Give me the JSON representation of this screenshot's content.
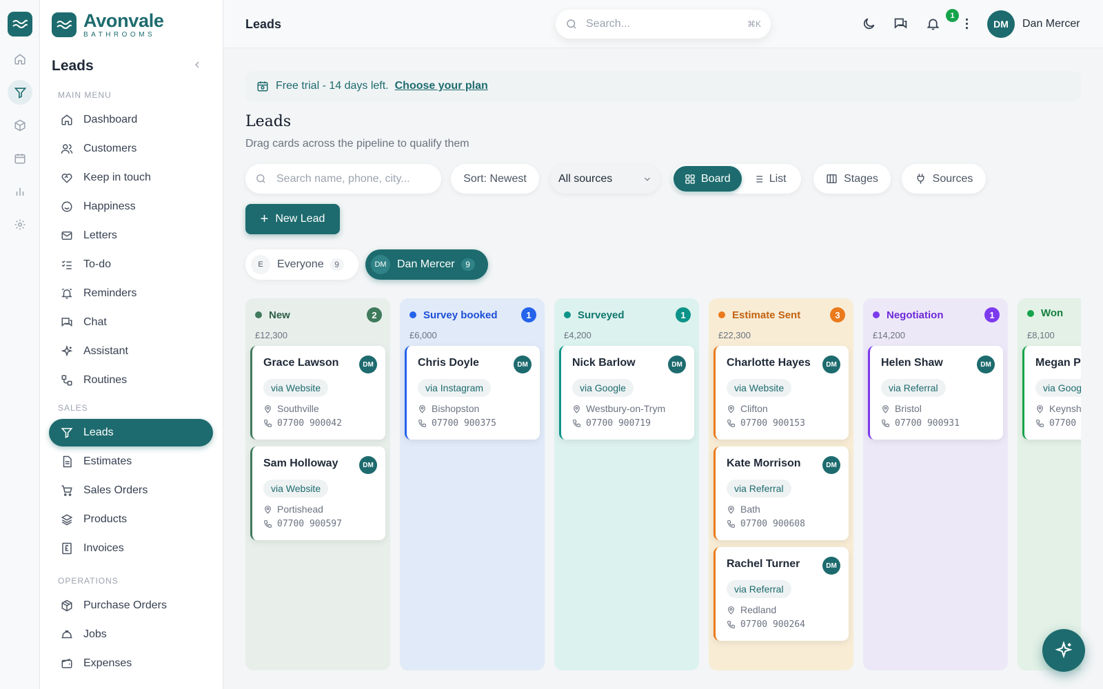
{
  "app": {
    "name": "Avonvale",
    "tagline": "BATHROOMS"
  },
  "sidebar": {
    "title": "Leads",
    "sections": {
      "main": "MAIN MENU",
      "sales": "SALES",
      "operations": "OPERATIONS"
    },
    "main_items": [
      "Dashboard",
      "Customers",
      "Keep in touch",
      "Happiness",
      "Letters",
      "To-do",
      "Reminders",
      "Chat",
      "Assistant",
      "Routines"
    ],
    "sales_items": [
      "Leads",
      "Estimates",
      "Sales Orders",
      "Products",
      "Invoices"
    ],
    "operations_items": [
      "Purchase Orders",
      "Jobs",
      "Expenses"
    ],
    "active": "Leads"
  },
  "topbar": {
    "page_title": "Leads",
    "search_placeholder": "Search...",
    "search_shortcut": "⌘K",
    "notification_count": "1",
    "user_initials": "DM",
    "user_name": "Dan Mercer"
  },
  "trial": {
    "text": "Free trial - 14 days left.",
    "link": "Choose your plan"
  },
  "page": {
    "heading": "Leads",
    "subtitle": "Drag cards across the pipeline to qualify them"
  },
  "toolbar": {
    "search_placeholder": "Search name, phone, city...",
    "sort": "Sort: Newest",
    "source_filter": "All sources",
    "view_board": "Board",
    "view_list": "List",
    "active_view": "Board",
    "stages": "Stages",
    "sources": "Sources",
    "new_lead": "New Lead"
  },
  "owners": [
    {
      "initial": "E",
      "label": "Everyone",
      "count": "9",
      "active": false
    },
    {
      "initial": "DM",
      "label": "Dan Mercer",
      "count": "9",
      "active": true
    }
  ],
  "colors": {
    "accent": "#1d6b6e"
  },
  "columns": [
    {
      "name": "New",
      "count": "2",
      "total": "£12,300",
      "color": "#3f7a5c",
      "text": "#2f5e46",
      "bg": "#e8efeb",
      "cards": [
        {
          "name": "Grace Lawson",
          "initials": "DM",
          "source": "via Website",
          "location": "Southville",
          "phone": "07700 900042"
        },
        {
          "name": "Sam Holloway",
          "initials": "DM",
          "source": "via Website",
          "location": "Portishead",
          "phone": "07700 900597"
        }
      ]
    },
    {
      "name": "Survey booked",
      "count": "1",
      "total": "£6,000",
      "color": "#2563eb",
      "text": "#1d4ed8",
      "bg": "#e0eaf8",
      "cards": [
        {
          "name": "Chris Doyle",
          "initials": "DM",
          "source": "via Instagram",
          "location": "Bishopston",
          "phone": "07700 900375"
        }
      ]
    },
    {
      "name": "Surveyed",
      "count": "1",
      "total": "£4,200",
      "color": "#0d9488",
      "text": "#0f766e",
      "bg": "#dcf2ee",
      "cards": [
        {
          "name": "Nick Barlow",
          "initials": "DM",
          "source": "via Google",
          "location": "Westbury-on-Trym",
          "phone": "07700 900719"
        }
      ]
    },
    {
      "name": "Estimate Sent",
      "count": "3",
      "total": "£22,300",
      "color": "#ea7a1c",
      "text": "#c2620e",
      "bg": "#f8ecd5",
      "cards": [
        {
          "name": "Charlotte Hayes",
          "initials": "DM",
          "source": "via Website",
          "location": "Clifton",
          "phone": "07700 900153"
        },
        {
          "name": "Kate Morrison",
          "initials": "DM",
          "source": "via Referral",
          "location": "Bath",
          "phone": "07700 900608"
        },
        {
          "name": "Rachel Turner",
          "initials": "DM",
          "source": "via Referral",
          "location": "Redland",
          "phone": "07700 900264"
        }
      ]
    },
    {
      "name": "Negotiation",
      "count": "1",
      "total": "£14,200",
      "color": "#7c3aed",
      "text": "#6d28d9",
      "bg": "#ede8f8",
      "cards": [
        {
          "name": "Helen Shaw",
          "initials": "DM",
          "source": "via Referral",
          "location": "Bristol",
          "phone": "07700 900931"
        }
      ]
    },
    {
      "name": "Won",
      "count": "",
      "total": "£8,100",
      "color": "#16a34a",
      "text": "#15803d",
      "bg": "#e3f1e7",
      "cards": [
        {
          "name": "Megan Pr",
          "initials": "",
          "source": "via Goog",
          "location": "Keynsh",
          "phone": "07700"
        }
      ]
    }
  ]
}
